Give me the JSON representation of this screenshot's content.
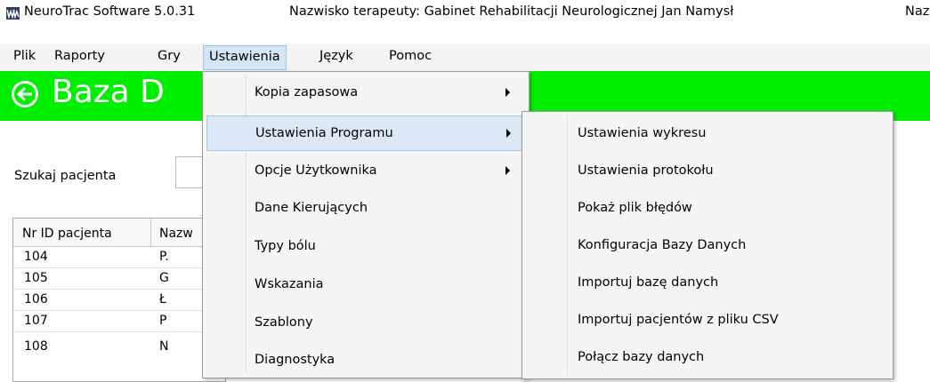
{
  "window": {
    "app_title": "NeuroTrac Software 5.0.31",
    "therapist": "Nazwisko terapeuty: Gabinet Rehabilitacji Neurologicznej Jan Namysł",
    "cut_text": "Nazw"
  },
  "menubar": [
    "Plik",
    "Raporty",
    "Gry",
    "Ustawienia",
    "Język",
    "Pomoc"
  ],
  "header": {
    "title": "Baza D",
    "accent": "#00ee00"
  },
  "search": {
    "label": "Szukaj pacjenta"
  },
  "table": {
    "columns": [
      "Nr ID pacjenta",
      "Nazw"
    ],
    "rows": [
      [
        "104",
        "P."
      ],
      [
        "105",
        "G"
      ],
      [
        "106",
        "Ł"
      ],
      [
        "107",
        "P"
      ],
      [
        "108",
        "N"
      ]
    ]
  },
  "dropdown": {
    "items": [
      {
        "label": "Kopia zapasowa",
        "submenu": true
      },
      {
        "label": "Ustawienia Programu",
        "submenu": true
      },
      {
        "label": "Opcje Użytkownika",
        "submenu": true
      },
      {
        "label": "Dane Kierujących",
        "submenu": false
      },
      {
        "label": "Typy bólu",
        "submenu": false
      },
      {
        "label": "Wskazania",
        "submenu": false
      },
      {
        "label": "Szablony",
        "submenu": false
      },
      {
        "label": "Diagnostyka",
        "submenu": false
      }
    ]
  },
  "submenu": {
    "items": [
      "Ustawienia wykresu",
      "Ustawienia protokołu",
      "Pokaż plik błędów",
      "Konfiguracja Bazy Danych",
      "Importuj bazę danych",
      "Importuj pacjentów z pliku CSV",
      "Połącz bazy danych"
    ]
  }
}
